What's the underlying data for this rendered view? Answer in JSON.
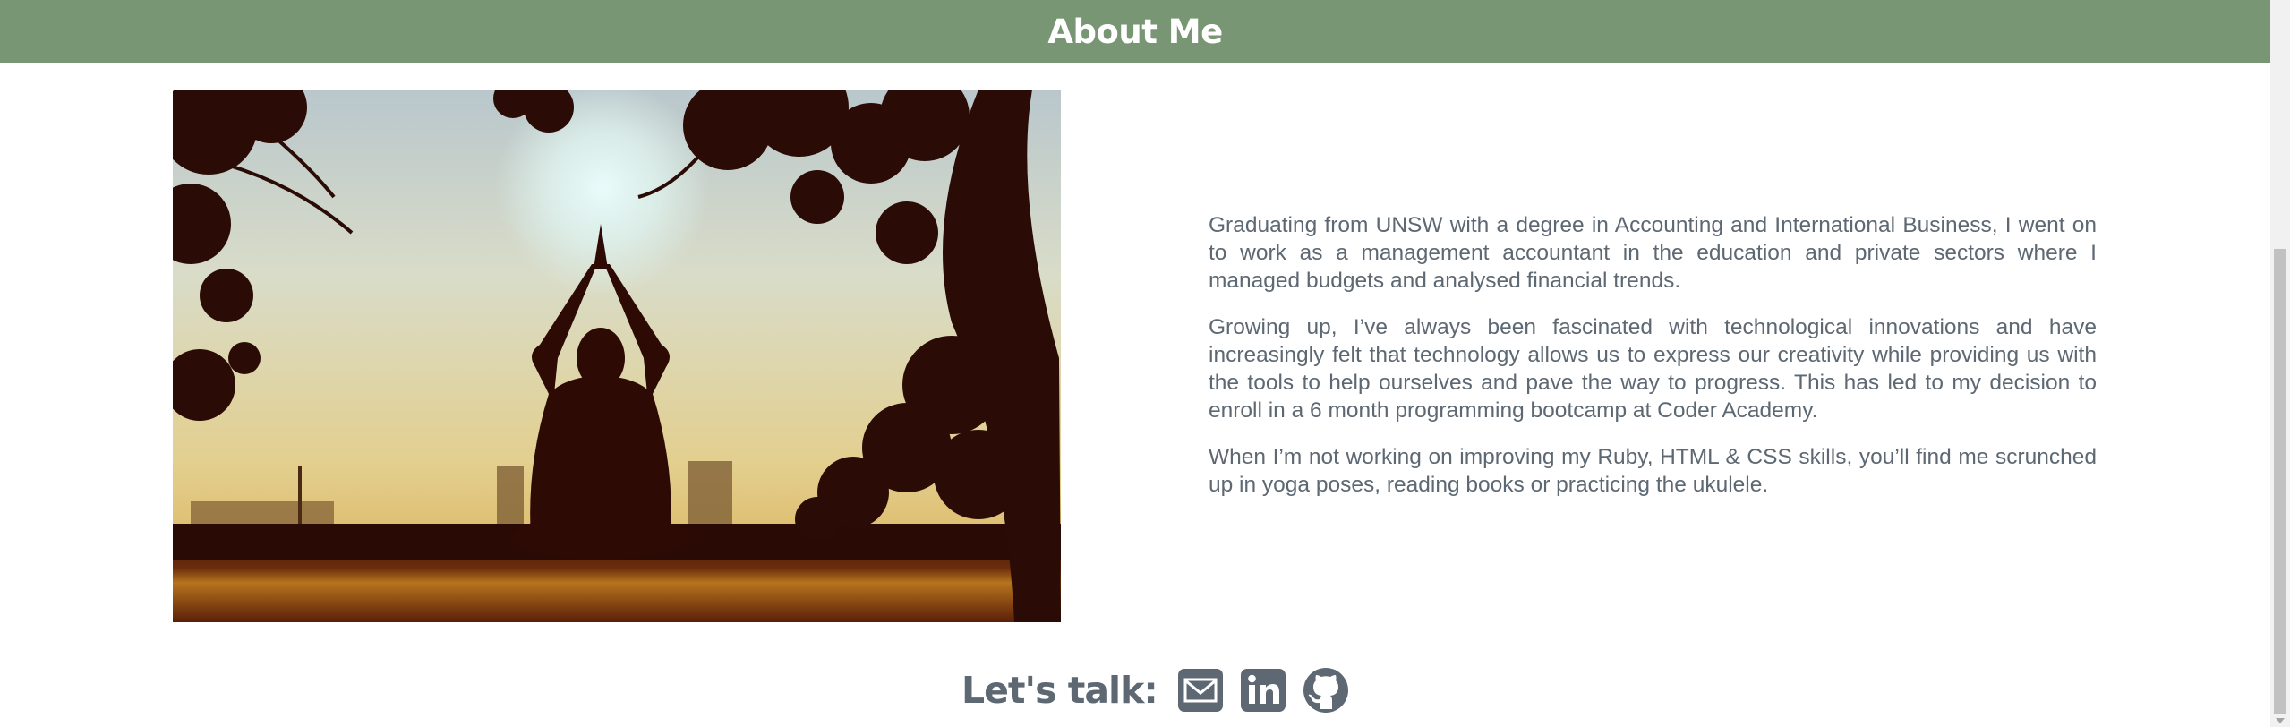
{
  "header": {
    "title": "About Me"
  },
  "bio": {
    "paragraphs": [
      "Graduating from UNSW with a degree in Accounting and International Business, I went on to work as a management accountant in the education and private sectors where I managed budgets and analysed financial trends.",
      "Growing up, I’ve always been fascinated with technological innovations and have increasingly felt that technology allows us to express our creativity while providing us with the tools to help ourselves and pave the way to progress. This has led to my decision to enroll in a 6 month programming bootcamp at Coder Academy.",
      "When I’m not working on improving my Ruby, HTML & CSS skills, you’ll find me scrunched up in yoga poses, reading books or practicing the ukulele."
    ]
  },
  "contact": {
    "label": "Let's talk:",
    "icons": [
      "envelope-icon",
      "linkedin-icon",
      "github-icon"
    ]
  },
  "colors": {
    "banner": "#789673",
    "text": "#5d6873",
    "icon": "#5d6873"
  }
}
